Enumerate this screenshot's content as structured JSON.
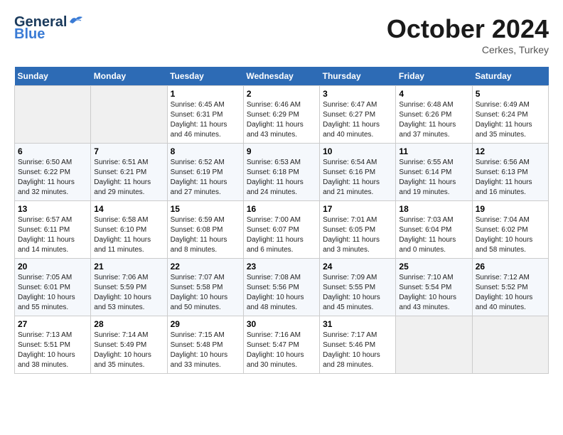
{
  "header": {
    "logo_general": "General",
    "logo_blue": "Blue",
    "month": "October 2024",
    "location": "Cerkes, Turkey"
  },
  "days_of_week": [
    "Sunday",
    "Monday",
    "Tuesday",
    "Wednesday",
    "Thursday",
    "Friday",
    "Saturday"
  ],
  "weeks": [
    [
      {
        "day": "",
        "info": ""
      },
      {
        "day": "",
        "info": ""
      },
      {
        "day": "1",
        "sunrise": "Sunrise: 6:45 AM",
        "sunset": "Sunset: 6:31 PM",
        "daylight": "Daylight: 11 hours and 46 minutes."
      },
      {
        "day": "2",
        "sunrise": "Sunrise: 6:46 AM",
        "sunset": "Sunset: 6:29 PM",
        "daylight": "Daylight: 11 hours and 43 minutes."
      },
      {
        "day": "3",
        "sunrise": "Sunrise: 6:47 AM",
        "sunset": "Sunset: 6:27 PM",
        "daylight": "Daylight: 11 hours and 40 minutes."
      },
      {
        "day": "4",
        "sunrise": "Sunrise: 6:48 AM",
        "sunset": "Sunset: 6:26 PM",
        "daylight": "Daylight: 11 hours and 37 minutes."
      },
      {
        "day": "5",
        "sunrise": "Sunrise: 6:49 AM",
        "sunset": "Sunset: 6:24 PM",
        "daylight": "Daylight: 11 hours and 35 minutes."
      }
    ],
    [
      {
        "day": "6",
        "sunrise": "Sunrise: 6:50 AM",
        "sunset": "Sunset: 6:22 PM",
        "daylight": "Daylight: 11 hours and 32 minutes."
      },
      {
        "day": "7",
        "sunrise": "Sunrise: 6:51 AM",
        "sunset": "Sunset: 6:21 PM",
        "daylight": "Daylight: 11 hours and 29 minutes."
      },
      {
        "day": "8",
        "sunrise": "Sunrise: 6:52 AM",
        "sunset": "Sunset: 6:19 PM",
        "daylight": "Daylight: 11 hours and 27 minutes."
      },
      {
        "day": "9",
        "sunrise": "Sunrise: 6:53 AM",
        "sunset": "Sunset: 6:18 PM",
        "daylight": "Daylight: 11 hours and 24 minutes."
      },
      {
        "day": "10",
        "sunrise": "Sunrise: 6:54 AM",
        "sunset": "Sunset: 6:16 PM",
        "daylight": "Daylight: 11 hours and 21 minutes."
      },
      {
        "day": "11",
        "sunrise": "Sunrise: 6:55 AM",
        "sunset": "Sunset: 6:14 PM",
        "daylight": "Daylight: 11 hours and 19 minutes."
      },
      {
        "day": "12",
        "sunrise": "Sunrise: 6:56 AM",
        "sunset": "Sunset: 6:13 PM",
        "daylight": "Daylight: 11 hours and 16 minutes."
      }
    ],
    [
      {
        "day": "13",
        "sunrise": "Sunrise: 6:57 AM",
        "sunset": "Sunset: 6:11 PM",
        "daylight": "Daylight: 11 hours and 14 minutes."
      },
      {
        "day": "14",
        "sunrise": "Sunrise: 6:58 AM",
        "sunset": "Sunset: 6:10 PM",
        "daylight": "Daylight: 11 hours and 11 minutes."
      },
      {
        "day": "15",
        "sunrise": "Sunrise: 6:59 AM",
        "sunset": "Sunset: 6:08 PM",
        "daylight": "Daylight: 11 hours and 8 minutes."
      },
      {
        "day": "16",
        "sunrise": "Sunrise: 7:00 AM",
        "sunset": "Sunset: 6:07 PM",
        "daylight": "Daylight: 11 hours and 6 minutes."
      },
      {
        "day": "17",
        "sunrise": "Sunrise: 7:01 AM",
        "sunset": "Sunset: 6:05 PM",
        "daylight": "Daylight: 11 hours and 3 minutes."
      },
      {
        "day": "18",
        "sunrise": "Sunrise: 7:03 AM",
        "sunset": "Sunset: 6:04 PM",
        "daylight": "Daylight: 11 hours and 0 minutes."
      },
      {
        "day": "19",
        "sunrise": "Sunrise: 7:04 AM",
        "sunset": "Sunset: 6:02 PM",
        "daylight": "Daylight: 10 hours and 58 minutes."
      }
    ],
    [
      {
        "day": "20",
        "sunrise": "Sunrise: 7:05 AM",
        "sunset": "Sunset: 6:01 PM",
        "daylight": "Daylight: 10 hours and 55 minutes."
      },
      {
        "day": "21",
        "sunrise": "Sunrise: 7:06 AM",
        "sunset": "Sunset: 5:59 PM",
        "daylight": "Daylight: 10 hours and 53 minutes."
      },
      {
        "day": "22",
        "sunrise": "Sunrise: 7:07 AM",
        "sunset": "Sunset: 5:58 PM",
        "daylight": "Daylight: 10 hours and 50 minutes."
      },
      {
        "day": "23",
        "sunrise": "Sunrise: 7:08 AM",
        "sunset": "Sunset: 5:56 PM",
        "daylight": "Daylight: 10 hours and 48 minutes."
      },
      {
        "day": "24",
        "sunrise": "Sunrise: 7:09 AM",
        "sunset": "Sunset: 5:55 PM",
        "daylight": "Daylight: 10 hours and 45 minutes."
      },
      {
        "day": "25",
        "sunrise": "Sunrise: 7:10 AM",
        "sunset": "Sunset: 5:54 PM",
        "daylight": "Daylight: 10 hours and 43 minutes."
      },
      {
        "day": "26",
        "sunrise": "Sunrise: 7:12 AM",
        "sunset": "Sunset: 5:52 PM",
        "daylight": "Daylight: 10 hours and 40 minutes."
      }
    ],
    [
      {
        "day": "27",
        "sunrise": "Sunrise: 7:13 AM",
        "sunset": "Sunset: 5:51 PM",
        "daylight": "Daylight: 10 hours and 38 minutes."
      },
      {
        "day": "28",
        "sunrise": "Sunrise: 7:14 AM",
        "sunset": "Sunset: 5:49 PM",
        "daylight": "Daylight: 10 hours and 35 minutes."
      },
      {
        "day": "29",
        "sunrise": "Sunrise: 7:15 AM",
        "sunset": "Sunset: 5:48 PM",
        "daylight": "Daylight: 10 hours and 33 minutes."
      },
      {
        "day": "30",
        "sunrise": "Sunrise: 7:16 AM",
        "sunset": "Sunset: 5:47 PM",
        "daylight": "Daylight: 10 hours and 30 minutes."
      },
      {
        "day": "31",
        "sunrise": "Sunrise: 7:17 AM",
        "sunset": "Sunset: 5:46 PM",
        "daylight": "Daylight: 10 hours and 28 minutes."
      },
      {
        "day": "",
        "info": ""
      },
      {
        "day": "",
        "info": ""
      }
    ]
  ]
}
